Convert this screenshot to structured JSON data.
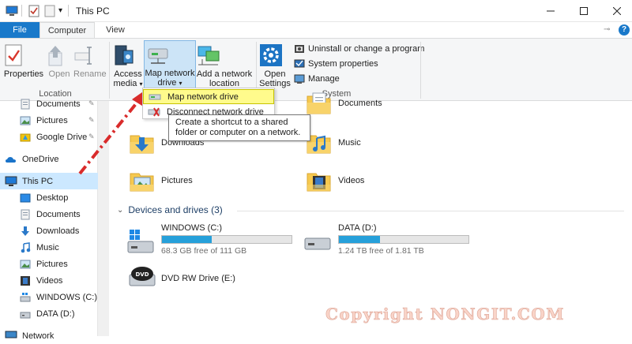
{
  "window": {
    "title": "This PC",
    "qat_icons": [
      "computer-icon",
      "properties-check-icon",
      "new-folder-icon",
      "customize-qat-icon"
    ]
  },
  "tabs": {
    "file": "File",
    "computer": "Computer",
    "view": "View"
  },
  "ribbon": {
    "location": {
      "label": "Location",
      "properties": "Properties",
      "open": "Open",
      "rename": "Rename"
    },
    "network": {
      "access_media_1": "Access",
      "access_media_2": "media",
      "map_drive_1": "Map network",
      "map_drive_2": "drive",
      "add_location_1": "Add a network",
      "add_location_2": "location"
    },
    "system": {
      "label": "System",
      "open_settings_1": "Open",
      "open_settings_2": "Settings",
      "uninstall": "Uninstall or change a program",
      "system_properties": "System properties",
      "manage": "Manage"
    }
  },
  "dropdown": {
    "map": "Map network drive",
    "disconnect": "Disconnect network drive"
  },
  "tooltip": {
    "line1": "Create a shortcut to a shared",
    "line2": "folder or computer on a network."
  },
  "nav": {
    "documents_quick": "Documents",
    "pictures_quick": "Pictures",
    "google_drive": "Google Drive",
    "onedrive": "OneDrive",
    "this_pc": "This PC",
    "desktop": "Desktop",
    "documents": "Documents",
    "downloads": "Downloads",
    "music": "Music",
    "pictures": "Pictures",
    "videos": "Videos",
    "windows_c": "WINDOWS (C:)",
    "data_d": "DATA (D:)",
    "network": "Network"
  },
  "folders": {
    "documents": "Documents",
    "downloads": "Downloads",
    "music": "Music",
    "pictures": "Pictures",
    "videos": "Videos"
  },
  "devices": {
    "header": "Devices and drives (3)",
    "drives": [
      {
        "name": "WINDOWS (C:)",
        "free": "68.3 GB free of 111 GB",
        "used_fraction": 0.385
      },
      {
        "name": "DATA (D:)",
        "free": "1.24 TB free of 1.81 TB",
        "used_fraction": 0.315
      },
      {
        "name": "DVD RW Drive (E:)"
      }
    ]
  },
  "watermark": "Copyright NONGIT.COM",
  "colors": {
    "accent": "#1979ca",
    "highlight": "#fffb8c",
    "selected": "#cce8ff",
    "drive_fill": "#26a0da"
  }
}
